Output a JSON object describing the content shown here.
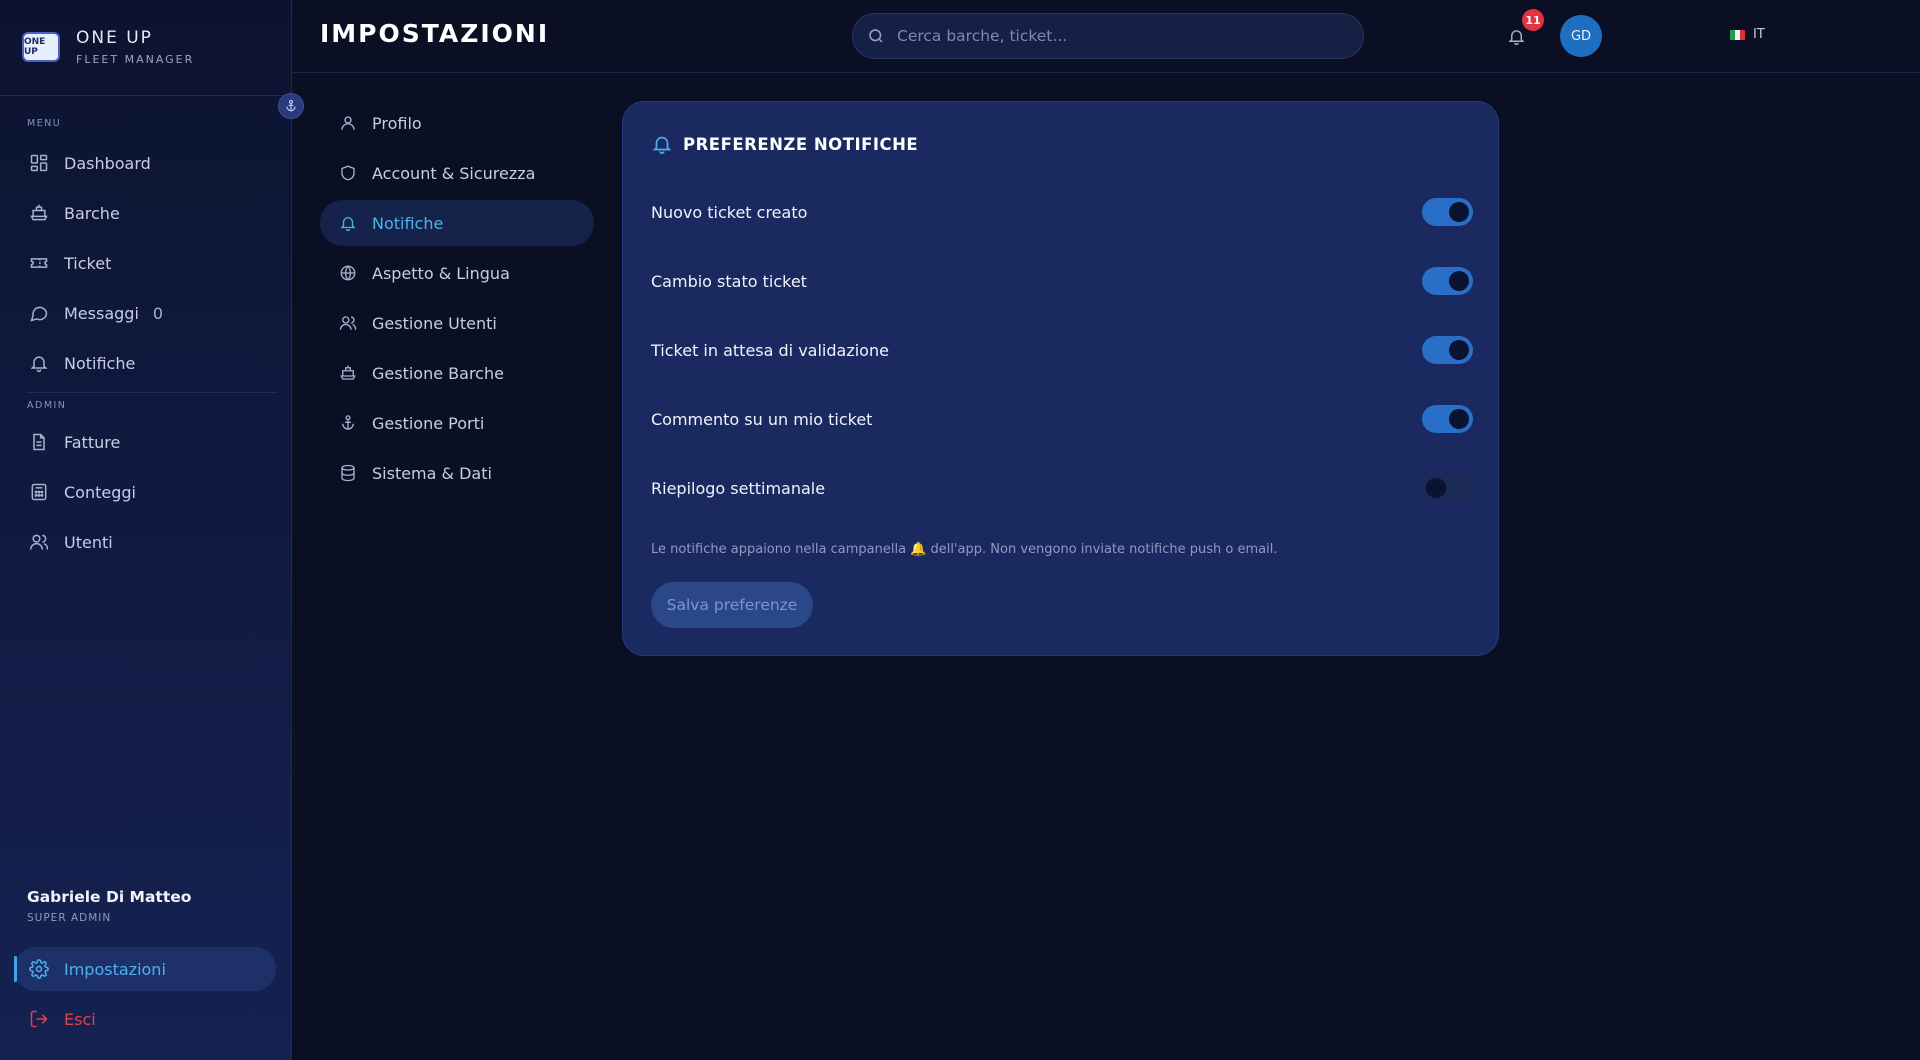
{
  "brand": {
    "logo_text": "ONE UP",
    "title": "ONE UP",
    "subtitle": "FLEET MANAGER"
  },
  "sidebar": {
    "menu_label": "MENU",
    "menu_items": [
      {
        "label": "Dashboard",
        "icon": "dashboard-icon"
      },
      {
        "label": "Barche",
        "icon": "boat-icon"
      },
      {
        "label": "Ticket",
        "icon": "ticket-icon"
      },
      {
        "label": "Messaggi",
        "icon": "message-icon",
        "count": "0"
      },
      {
        "label": "Notifiche",
        "icon": "bell-icon"
      }
    ],
    "admin_label": "ADMIN",
    "admin_items": [
      {
        "label": "Fatture",
        "icon": "invoice-icon"
      },
      {
        "label": "Conteggi",
        "icon": "calculator-icon"
      },
      {
        "label": "Utenti",
        "icon": "users-icon"
      }
    ],
    "user": {
      "name": "Gabriele Di Matteo",
      "role": "SUPER ADMIN"
    },
    "settings_label": "Impostazioni",
    "logout_label": "Esci"
  },
  "header": {
    "title": "IMPOSTAZIONI",
    "search_placeholder": "Cerca barche, ticket...",
    "language": "IT",
    "notification_count": "11",
    "avatar_initials": "GD"
  },
  "settings_nav": [
    {
      "label": "Profilo",
      "icon": "user-icon",
      "active": false
    },
    {
      "label": "Account & Sicurezza",
      "icon": "shield-icon",
      "active": false
    },
    {
      "label": "Notifiche",
      "icon": "bell-icon",
      "active": true
    },
    {
      "label": "Aspetto & Lingua",
      "icon": "globe-icon",
      "active": false
    },
    {
      "label": "Gestione Utenti",
      "icon": "users-icon",
      "active": false
    },
    {
      "label": "Gestione Barche",
      "icon": "boat-icon",
      "active": false
    },
    {
      "label": "Gestione Porti",
      "icon": "anchor-icon",
      "active": false
    },
    {
      "label": "Sistema & Dati",
      "icon": "database-icon",
      "active": false
    }
  ],
  "card": {
    "title": "PREFERENZE NOTIFICHE",
    "preferences": [
      {
        "label": "Nuovo ticket creato",
        "enabled": true
      },
      {
        "label": "Cambio stato ticket",
        "enabled": true
      },
      {
        "label": "Ticket in attesa di validazione",
        "enabled": true
      },
      {
        "label": "Commento su un mio ticket",
        "enabled": true
      },
      {
        "label": "Riepilogo settimanale",
        "enabled": false
      }
    ],
    "note": "Le notifiche appaiono nella campanella 🔔 dell'app. Non vengono inviate notifiche push o email.",
    "save_label": "Salva preferenze"
  },
  "colors": {
    "accent": "#4fb0ee",
    "toggle_on": "#2a6fc7",
    "danger": "#e0414f",
    "background": "#0a0f24"
  }
}
